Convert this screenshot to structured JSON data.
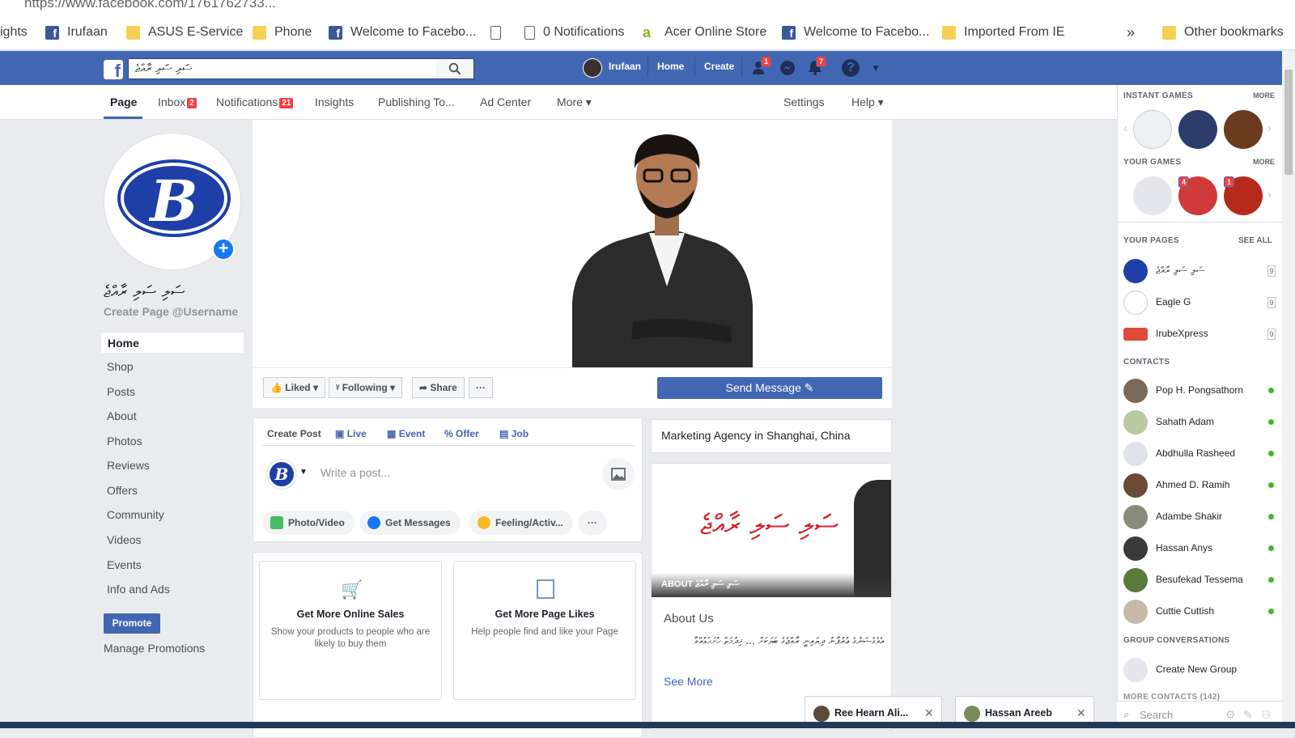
{
  "browser": {
    "url": "https://www.facebook.com/1761762733...",
    "bookmarks": [
      {
        "label": "ights",
        "icon": "none"
      },
      {
        "label": "Irufaan",
        "icon": "facebook-icon"
      },
      {
        "label": "ASUS E-Service",
        "icon": "folder-icon"
      },
      {
        "label": "Phone",
        "icon": "folder-icon"
      },
      {
        "label": "Welcome to Facebo...",
        "icon": "facebook-icon"
      },
      {
        "label": "",
        "icon": "document-icon"
      },
      {
        "label": "0 Notifications",
        "icon": "document-icon"
      },
      {
        "label": "Acer Online Store",
        "icon": "acer-icon"
      },
      {
        "label": "Welcome to Facebo...",
        "icon": "facebook-icon"
      },
      {
        "label": "Imported From IE",
        "icon": "folder-icon"
      }
    ],
    "overflow_label": "»",
    "other_bookmarks": "Other bookmarks"
  },
  "topbar": {
    "search_value": "ސަލި ސަލި ރާއްޖެ",
    "profile_name": "Irufaan",
    "home": "Home",
    "create": "Create",
    "friend_requests_badge": "1",
    "notifications_badge": "7",
    "brand_color": "#4267b2"
  },
  "page_tabs": {
    "page": "Page",
    "inbox": "Inbox",
    "inbox_badge": "2",
    "notifications": "Notifications",
    "notifications_badge": "21",
    "insights": "Insights",
    "publishing": "Publishing To...",
    "ad_center": "Ad Center",
    "more": "More ▾",
    "settings": "Settings",
    "help": "Help ▾"
  },
  "left": {
    "page_name": "ސަލި ސަލި ރާއްޖެ",
    "username_link": "Create Page @Username",
    "avatar_letter": "B",
    "nav": [
      "Home",
      "Shop",
      "Posts",
      "About",
      "Photos",
      "Reviews",
      "Offers",
      "Community",
      "Videos",
      "Events",
      "Info and Ads"
    ],
    "promote": "Promote",
    "manage_promotions": "Manage Promotions"
  },
  "actions": {
    "liked": "Liked ▾",
    "following": "Following ▾",
    "share": "Share",
    "more": "···",
    "send_message": "Send Message ✎"
  },
  "composer": {
    "tabs": [
      "Create Post",
      "Live",
      "Event",
      "Offer",
      "Job"
    ],
    "placeholder": "Write a post...",
    "pills": [
      "Photo/Video",
      "Get Messages",
      "Feeling/Activ...",
      "···"
    ]
  },
  "promo_cards": [
    {
      "title": "Get More Online Sales",
      "desc": "Show your products to people who are likely to buy them"
    },
    {
      "title": "Get More Page Likes",
      "desc": "Help people find and like your Page"
    }
  ],
  "about": {
    "category": "Marketing Agency in Shanghai, China",
    "banner_text": "ސަލި ސަލި ރާއްޖެ",
    "strip_label": "ABOUT ސަލި ސަލި ރާއްޖެ",
    "heading": "About Us",
    "body": "އެވެގެޝަނުގެ ޢުރުފާނު ދިޔައިނީ ރާއްޖެގެ ބަޔަކަށް ... ޚިދުމަތް ހުށަހަޅުއްވާ",
    "see_more": "See More"
  },
  "sidebar": {
    "instant_games": "INSTANT GAMES",
    "your_games": "YOUR GAMES",
    "more": "MORE",
    "your_games_badges": [
      "4",
      "1"
    ],
    "your_pages": "YOUR PAGES",
    "see_all": "SEE ALL",
    "pages": [
      {
        "name": "ސަލި ސަލި ރާއްޖެ",
        "count": "9"
      },
      {
        "name": "Eagle G",
        "count": "9"
      },
      {
        "name": "IrubeXpress",
        "count": "9"
      }
    ],
    "contacts_header": "CONTACTS",
    "contacts": [
      "Pop H. Pongsathorn",
      "Sahath Adam",
      "Abdhulla Rasheed",
      "Ahmed D. Ramih",
      "Adambe Shakir",
      "Hassan Anys",
      "Besufekad Tessema",
      "Cuttie Cuttish"
    ],
    "group_header": "GROUP CONVERSATIONS",
    "create_group": "Create New Group",
    "more_contacts": "MORE CONTACTS (142)",
    "search_placeholder": "Search"
  },
  "chat_tabs": [
    "Ree Hearn Ali...",
    "Hassan Areeb"
  ]
}
